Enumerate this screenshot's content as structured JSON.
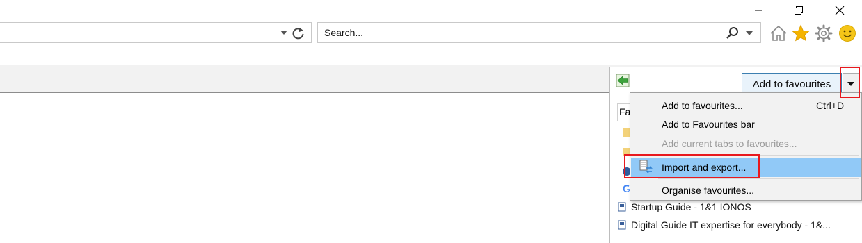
{
  "window": {
    "minimize_icon": "minimize-icon",
    "restore_icon": "restore-icon",
    "close_icon": "close-icon"
  },
  "search": {
    "placeholder": "Search..."
  },
  "toolbar": {
    "icons": [
      "home-icon",
      "favorites-star-icon",
      "settings-gear-icon",
      "smiley-feedback-icon"
    ]
  },
  "favourites": {
    "add_button_label": "Add to favourites",
    "header_label": "Favourites",
    "items": [
      {
        "label": "Startup Guide - 1&1 IONOS",
        "icon": "page-icon"
      },
      {
        "label": "Digital Guide  IT expertise for everybody - 1&...",
        "icon": "page-icon"
      }
    ]
  },
  "menu": {
    "items": [
      {
        "label": "Add to favourites...",
        "shortcut": "Ctrl+D",
        "state": "enabled"
      },
      {
        "label": "Add to Favourites bar",
        "shortcut": "",
        "state": "enabled"
      },
      {
        "label": "Add current tabs to favourites...",
        "shortcut": "",
        "state": "disabled"
      },
      {
        "label": "Import and export...",
        "shortcut": "",
        "state": "highlighted"
      },
      {
        "label": "Organise favourites...",
        "shortcut": "",
        "state": "enabled"
      }
    ]
  },
  "colors": {
    "menu_highlight": "#91c9f7",
    "annotation_red": "#e8191e",
    "star": "#f5b400",
    "smiley": "#f5c518"
  }
}
